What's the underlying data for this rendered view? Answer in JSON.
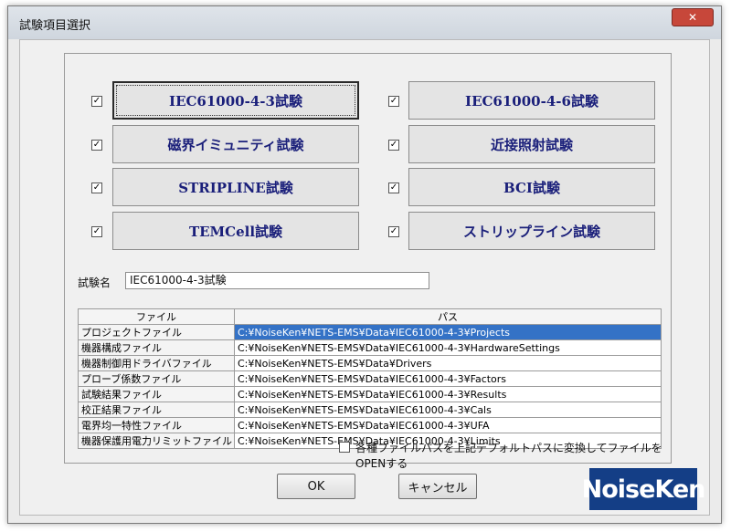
{
  "window": {
    "title": "試験項目選択",
    "close_label": "✕"
  },
  "tests": [
    {
      "label": "IEC61000-4-3試験",
      "checked": true
    },
    {
      "label": "IEC61000-4-6試験",
      "checked": true
    },
    {
      "label": "磁界イミュニティ試験",
      "checked": true
    },
    {
      "label": "近接照射試験",
      "checked": true
    },
    {
      "label": "STRIPLINE試験",
      "checked": true
    },
    {
      "label": "BCI試験",
      "checked": true
    },
    {
      "label": "TEMCell試験",
      "checked": true
    },
    {
      "label": "ストリップライン試験",
      "checked": true
    }
  ],
  "test_name": {
    "label": "試験名",
    "value": "IEC61000-4-3試験"
  },
  "file_table": {
    "headers": [
      "ファイル",
      "パス"
    ],
    "rows": [
      [
        "プロジェクトファイル",
        "C:¥NoiseKen¥NETS-EMS¥Data¥IEC61000-4-3¥Projects"
      ],
      [
        "機器構成ファイル",
        "C:¥NoiseKen¥NETS-EMS¥Data¥IEC61000-4-3¥HardwareSettings"
      ],
      [
        "機器制御用ドライバファイル",
        "C:¥NoiseKen¥NETS-EMS¥Data¥Drivers"
      ],
      [
        "プローブ係数ファイル",
        "C:¥NoiseKen¥NETS-EMS¥Data¥IEC61000-4-3¥Factors"
      ],
      [
        "試験結果ファイル",
        "C:¥NoiseKen¥NETS-EMS¥Data¥IEC61000-4-3¥Results"
      ],
      [
        "校正結果ファイル",
        "C:¥NoiseKen¥NETS-EMS¥Data¥IEC61000-4-3¥Cals"
      ],
      [
        "電界均一特性ファイル",
        "C:¥NoiseKen¥NETS-EMS¥Data¥IEC61000-4-3¥UFA"
      ],
      [
        "機器保護用電力リミットファイル",
        "C:¥NoiseKen¥NETS-EMS¥Data¥IEC61000-4-3¥Limits"
      ]
    ]
  },
  "convert_option": {
    "label": "各種ファイルパスを上記デフォルトパスに変換してファイルをOPENする",
    "checked": false
  },
  "buttons": {
    "ok": "OK",
    "cancel": "キャンセル"
  },
  "logo": {
    "text": "NoiseKen"
  }
}
